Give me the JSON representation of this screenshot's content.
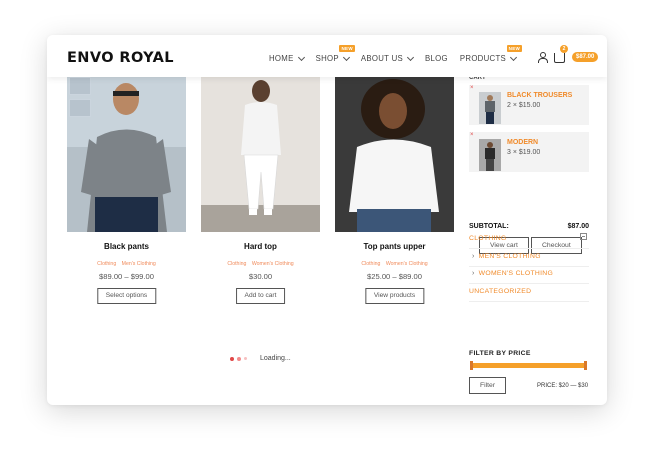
{
  "header": {
    "logo": "ENVO ROYAL",
    "nav": [
      {
        "label": "HOME",
        "dropdown": true,
        "badge": ""
      },
      {
        "label": "SHOP",
        "dropdown": true,
        "badge": "NEW"
      },
      {
        "label": "ABOUT US",
        "dropdown": true,
        "badge": ""
      },
      {
        "label": "BLOG",
        "dropdown": false,
        "badge": ""
      },
      {
        "label": "PRODUCTS",
        "dropdown": true,
        "badge": "NEW"
      }
    ],
    "cart_count": "2",
    "cart_total": "$87.00"
  },
  "products": [
    {
      "title": "Black pants",
      "cat1": "Clothing",
      "cat2": "Men's Clothing",
      "price": "$89.00 – $99.00",
      "button": "Select options"
    },
    {
      "title": "Hard top",
      "cat1": "Clothing",
      "cat2": "Women's Clothing",
      "price": "$30.00",
      "button": "Add to cart"
    },
    {
      "title": "Top pants upper",
      "cat1": "Clothing",
      "cat2": "Women's Clothing",
      "price": "$25.00 – $89.00",
      "button": "View products"
    }
  ],
  "loading_text": "Loading...",
  "sidebar": {
    "cart_heading": "CART",
    "items": [
      {
        "name": "BLACK TROUSERS",
        "qty": "2 × $15.00"
      },
      {
        "name": "MODERN",
        "qty": "3 × $19.00"
      }
    ],
    "subtotal_label": "SUBTOTAL:",
    "subtotal_value": "$87.00",
    "view_cart": "View cart",
    "checkout": "Checkout",
    "categories": {
      "clothing": "CLOTHING",
      "mens": "MEN'S CLOTHING",
      "womens": "WOMEN'S CLOTHING",
      "uncategorized": "UNCATEGORIZED"
    },
    "filter_heading": "FILTER BY PRICE",
    "filter_button": "Filter",
    "price_range": "PRICE: $20 — $30"
  },
  "colors": {
    "accent": "#f5a02a",
    "category_link": "#f08a5a",
    "remove": "#e04848"
  }
}
